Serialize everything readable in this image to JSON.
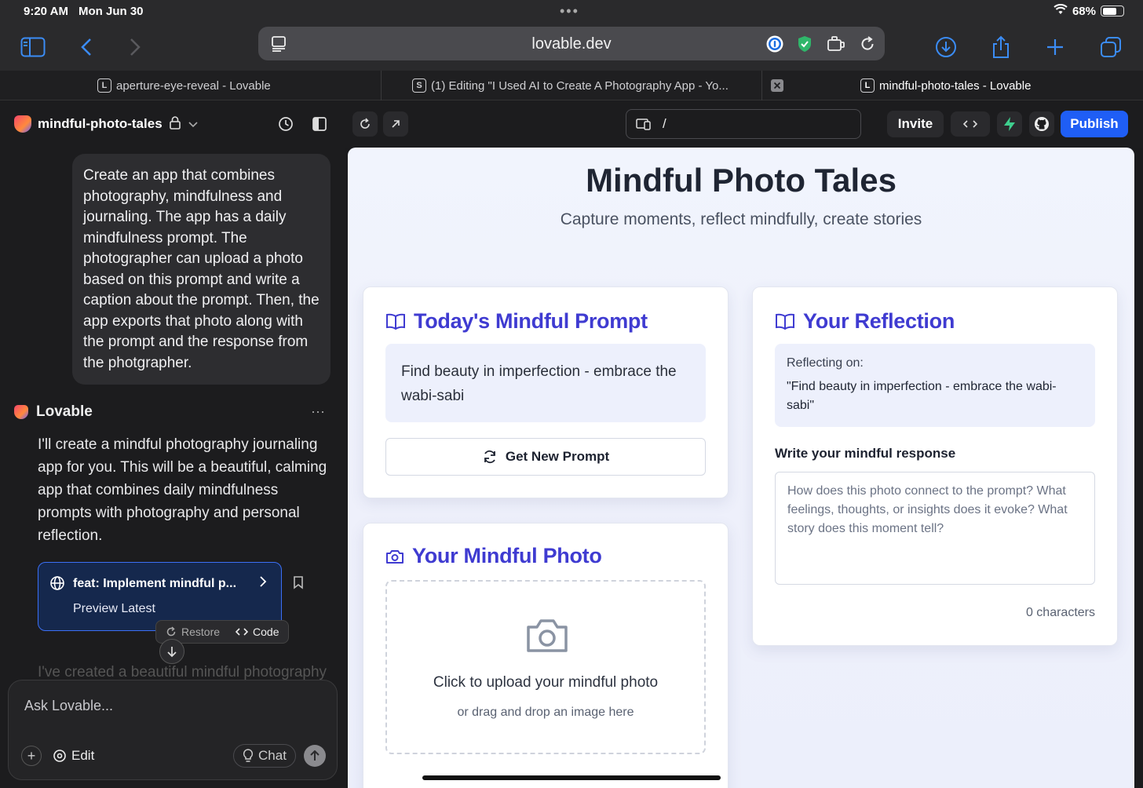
{
  "status": {
    "time": "9:20 AM",
    "date": "Mon Jun 30",
    "battery": "68%",
    "battery_level": 0.68
  },
  "browser": {
    "url": "lovable.dev",
    "tabs": [
      {
        "label": "aperture-eye-reveal - Lovable",
        "favicon": "L"
      },
      {
        "label": "(1) Editing \"I Used AI to Create A Photography App - Yo...",
        "favicon": "S"
      },
      {
        "label": "mindful-photo-tales - Lovable",
        "favicon": "L"
      }
    ]
  },
  "project": {
    "name": "mindful-photo-tales"
  },
  "chat": {
    "user_message": "Create an app that combines photography, mindfulness and journaling. The app has a daily mindfulness prompt. The photographer can upload a photo based on this prompt and write a caption about the prompt. Then, the app exports that photo along with the prompt and the response from the photgrapher.",
    "assistant_name": "Lovable",
    "assistant_message": "I'll create a mindful photography journaling app for you. This will be a beautiful, calming app that combines daily mindfulness prompts with photography and personal reflection.",
    "commit_title": "feat: Implement mindful p...",
    "commit_sub": "Preview Latest",
    "restore_label": "Restore",
    "code_label": "Code",
    "faded_message": "I've created a beautiful mindful photography",
    "input_placeholder": "Ask Lovable...",
    "edit_label": "Edit",
    "chat_label": "Chat"
  },
  "preview_header": {
    "path": "/",
    "invite_label": "Invite",
    "publish_label": "Publish"
  },
  "app": {
    "title": "Mindful Photo Tales",
    "subtitle": "Capture moments, reflect mindfully, create stories",
    "prompt_card": {
      "heading": "Today's Mindful Prompt",
      "prompt": "Find beauty in imperfection - embrace the wabi-sabi",
      "button": "Get New Prompt"
    },
    "photo_card": {
      "heading": "Your Mindful Photo",
      "upload_line1": "Click to upload your mindful photo",
      "upload_line2": "or drag and drop an image here"
    },
    "reflection_card": {
      "heading": "Your Reflection",
      "reflecting_label": "Reflecting on:",
      "reflecting_quote": "\"Find beauty in imperfection - embrace the wabi-sabi\"",
      "response_label": "Write your mindful response",
      "response_placeholder": "How does this photo connect to the prompt? What feelings, thoughts, or insights does it evoke? What story does this moment tell?",
      "char_count": "0 characters"
    }
  },
  "colors": {
    "accent": "#3f3bd1",
    "publish": "#1f5ef5",
    "link_blue": "#3b8cf5"
  }
}
